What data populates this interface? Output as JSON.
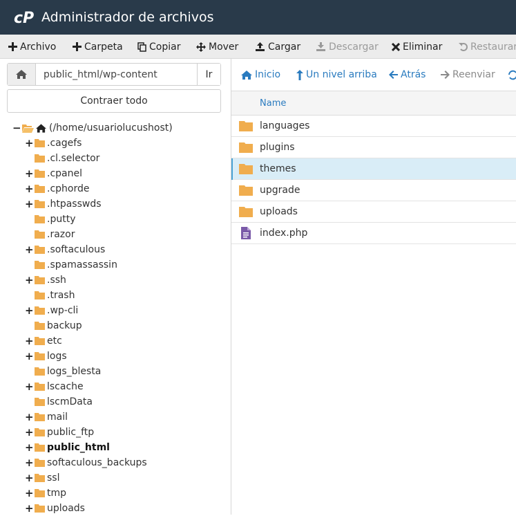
{
  "app": {
    "title": "Administrador de archivos"
  },
  "colors": {
    "header_bg": "#293a4a",
    "folder": "#f0ad4e",
    "file_php": "#7a5aa8",
    "link": "#2a7bbf",
    "selected_row": "#d9edf7"
  },
  "toolbar": [
    {
      "label": "Archivo",
      "icon": "plus-icon",
      "enabled": true
    },
    {
      "label": "Carpeta",
      "icon": "plus-icon",
      "enabled": true
    },
    {
      "label": "Copiar",
      "icon": "copy-icon",
      "enabled": true
    },
    {
      "label": "Mover",
      "icon": "move-icon",
      "enabled": true
    },
    {
      "label": "Cargar",
      "icon": "upload-icon",
      "enabled": true
    },
    {
      "label": "Descargar",
      "icon": "download-icon",
      "enabled": false
    },
    {
      "label": "Eliminar",
      "icon": "close-icon",
      "enabled": true
    },
    {
      "label": "Restaurar",
      "icon": "undo-icon",
      "enabled": false
    }
  ],
  "path": {
    "value": "public_html/wp-content",
    "go_label": "Ir"
  },
  "tree": {
    "collapse_label": "Contraer todo",
    "root_label": "(/home/usuariolucushost)",
    "items": [
      {
        "label": ".cagefs",
        "expandable": true,
        "bold": false
      },
      {
        "label": ".cl.selector",
        "expandable": false,
        "bold": false
      },
      {
        "label": ".cpanel",
        "expandable": true,
        "bold": false
      },
      {
        "label": ".cphorde",
        "expandable": true,
        "bold": false
      },
      {
        "label": ".htpasswds",
        "expandable": true,
        "bold": false
      },
      {
        "label": ".putty",
        "expandable": false,
        "bold": false
      },
      {
        "label": ".razor",
        "expandable": false,
        "bold": false
      },
      {
        "label": ".softaculous",
        "expandable": true,
        "bold": false
      },
      {
        "label": ".spamassassin",
        "expandable": false,
        "bold": false
      },
      {
        "label": ".ssh",
        "expandable": true,
        "bold": false
      },
      {
        "label": ".trash",
        "expandable": false,
        "bold": false
      },
      {
        "label": ".wp-cli",
        "expandable": true,
        "bold": false
      },
      {
        "label": "backup",
        "expandable": false,
        "bold": false
      },
      {
        "label": "etc",
        "expandable": true,
        "bold": false
      },
      {
        "label": "logs",
        "expandable": true,
        "bold": false
      },
      {
        "label": "logs_blesta",
        "expandable": false,
        "bold": false
      },
      {
        "label": "lscache",
        "expandable": true,
        "bold": false
      },
      {
        "label": "lscmData",
        "expandable": false,
        "bold": false
      },
      {
        "label": "mail",
        "expandable": true,
        "bold": false
      },
      {
        "label": "public_ftp",
        "expandable": true,
        "bold": false
      },
      {
        "label": "public_html",
        "expandable": true,
        "bold": true
      },
      {
        "label": "softaculous_backups",
        "expandable": true,
        "bold": false
      },
      {
        "label": "ssl",
        "expandable": true,
        "bold": false
      },
      {
        "label": "tmp",
        "expandable": true,
        "bold": false
      },
      {
        "label": "uploads",
        "expandable": true,
        "bold": false
      }
    ]
  },
  "nav": [
    {
      "label": "Inicio",
      "icon": "home-icon",
      "enabled": true
    },
    {
      "label": "Un nivel arriba",
      "icon": "level-up-icon",
      "enabled": true
    },
    {
      "label": "Atrás",
      "icon": "arrow-left-icon",
      "enabled": true
    },
    {
      "label": "Reenviar",
      "icon": "arrow-right-icon",
      "enabled": false
    }
  ],
  "files": {
    "column_name": "Name",
    "rows": [
      {
        "name": "languages",
        "type": "folder",
        "selected": false
      },
      {
        "name": "plugins",
        "type": "folder",
        "selected": false
      },
      {
        "name": "themes",
        "type": "folder",
        "selected": true
      },
      {
        "name": "upgrade",
        "type": "folder",
        "selected": false
      },
      {
        "name": "uploads",
        "type": "folder",
        "selected": false
      },
      {
        "name": "index.php",
        "type": "file",
        "selected": false
      }
    ]
  }
}
